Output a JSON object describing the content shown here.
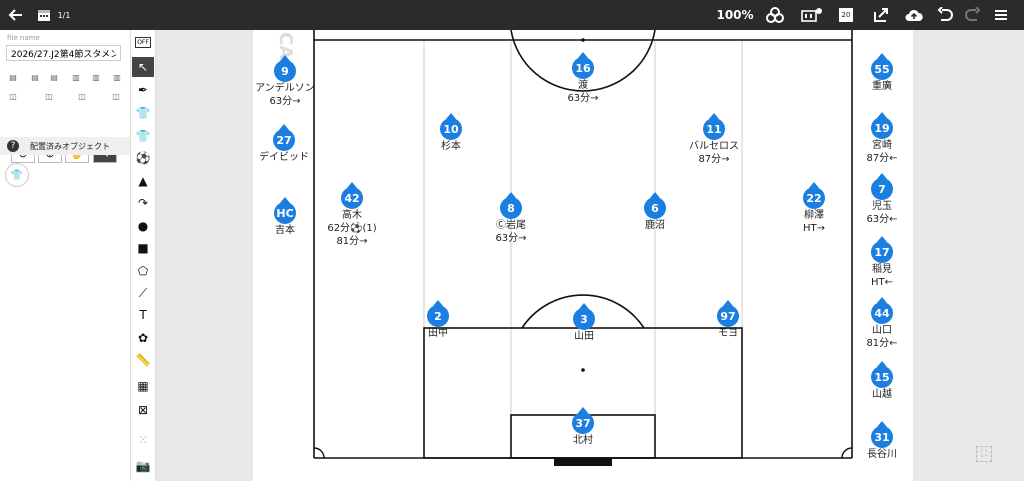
{
  "toolbar": {
    "page_indicator": "1/1",
    "zoom_level": "100%",
    "counter_badge": "20"
  },
  "sidebar": {
    "file_name_label": "file name",
    "file_name_value": "2026/27.J2第4節スタメン",
    "placed_objects_label": "配置済みオブジェクト",
    "tool_off_label": "OFF"
  },
  "pitch": {
    "watermark": "CA"
  },
  "players": [
    {
      "id": "p9",
      "num": "9",
      "name": "アンデルソン",
      "note": "63分→"
    },
    {
      "id": "p27",
      "num": "27",
      "name": "デイビッド",
      "note": ""
    },
    {
      "id": "hc",
      "num": "HC",
      "name": "吉本",
      "note": ""
    },
    {
      "id": "p16",
      "num": "16",
      "name": "渡",
      "note": "63分→"
    },
    {
      "id": "p10",
      "num": "10",
      "name": "杉本",
      "note": ""
    },
    {
      "id": "p11",
      "num": "11",
      "name": "バルセロス",
      "note": "87分→"
    },
    {
      "id": "p42",
      "num": "42",
      "name": "高木",
      "note": "62分⚽(1)",
      "note2": "81分→"
    },
    {
      "id": "p8",
      "num": "8",
      "name": "Ⓒ岩尾",
      "note": "63分→"
    },
    {
      "id": "p6",
      "num": "6",
      "name": "鹿沼",
      "note": ""
    },
    {
      "id": "p22",
      "num": "22",
      "name": "柳澤",
      "note": "HT→"
    },
    {
      "id": "p2",
      "num": "2",
      "name": "田中",
      "note": ""
    },
    {
      "id": "p3",
      "num": "3",
      "name": "山田",
      "note": ""
    },
    {
      "id": "p97",
      "num": "97",
      "name": "モヨ",
      "note": ""
    },
    {
      "id": "p37",
      "num": "37",
      "name": "北村",
      "note": ""
    },
    {
      "id": "p55",
      "num": "55",
      "name": "重廣",
      "note": ""
    },
    {
      "id": "p19",
      "num": "19",
      "name": "宮崎",
      "note": "87分←"
    },
    {
      "id": "p7",
      "num": "7",
      "name": "児玉",
      "note": "63分←"
    },
    {
      "id": "p17",
      "num": "17",
      "name": "稲見",
      "note": "HT←"
    },
    {
      "id": "p44",
      "num": "44",
      "name": "山口",
      "note": "81分←"
    },
    {
      "id": "p15",
      "num": "15",
      "name": "山越",
      "note": ""
    },
    {
      "id": "p31",
      "num": "31",
      "name": "長谷川",
      "note": ""
    }
  ]
}
